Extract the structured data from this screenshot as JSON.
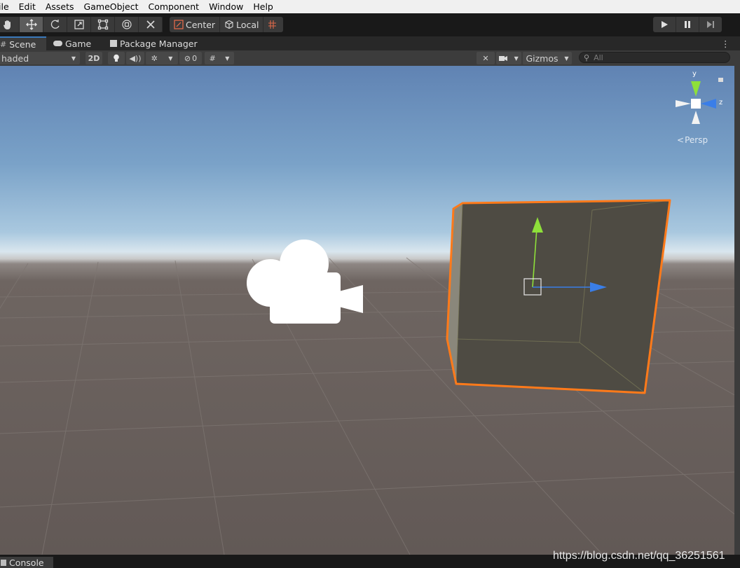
{
  "menu": [
    "ile",
    "Edit",
    "Assets",
    "GameObject",
    "Component",
    "Window",
    "Help"
  ],
  "toolbar": {
    "tools": [
      "hand-tool",
      "move-tool",
      "rotate-tool",
      "scale-tool",
      "rect-tool",
      "transform-tool",
      "custom-tool"
    ],
    "active_tool": "move-tool",
    "pivot_label": "Center",
    "space_label": "Local",
    "play_controls": [
      "play",
      "pause",
      "step"
    ]
  },
  "tabs": {
    "scene": "Scene",
    "game": "Game",
    "package_manager": "Package Manager"
  },
  "scenebar": {
    "draw_mode": "haded",
    "mode_2d": "2D",
    "hidden_count": "0",
    "gizmos": "Gizmos",
    "search_placeholder": "All"
  },
  "gizmo": {
    "y": "y",
    "z": "z",
    "projection": "Persp"
  },
  "console_tab": "Console",
  "watermark": "https://blog.csdn.net/qq_36251561",
  "colors": {
    "selection_outline": "#ff7a1a",
    "axis_y": "#8ee03a",
    "axis_z": "#3a7ee8",
    "sky_top": "#6083b3",
    "ground": "#625956"
  }
}
